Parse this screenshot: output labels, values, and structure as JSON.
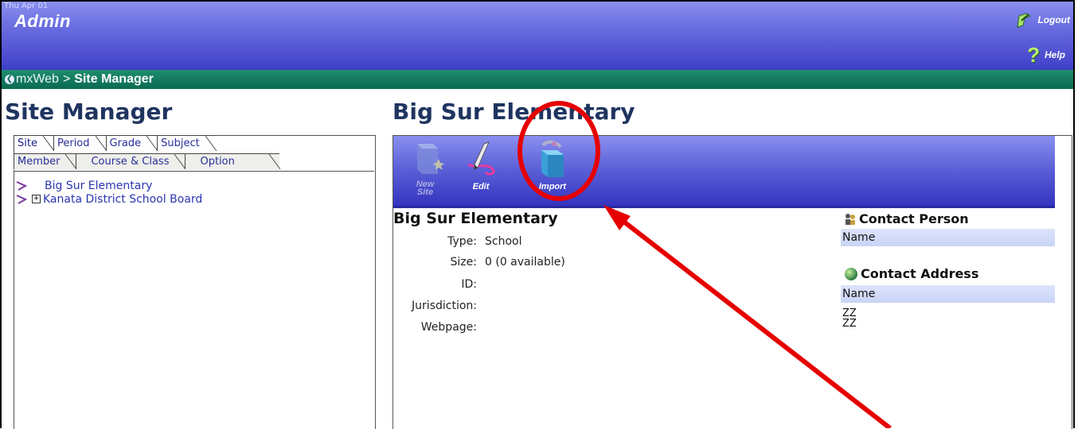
{
  "header": {
    "date": "Thu Apr 01",
    "app_title": "Admin",
    "logout_label": "Logout",
    "help_label": "Help"
  },
  "breadcrumb": {
    "root": "mxWeb",
    "separator": ">",
    "current": "Site Manager"
  },
  "left": {
    "title": "Site Manager",
    "tabs_row1": [
      "Site",
      "Period",
      "Grade",
      "Subject"
    ],
    "tabs_row2": [
      "Member",
      "Course & Class",
      "Option"
    ],
    "tree": [
      {
        "label": "Big Sur Elementary",
        "expandable": false
      },
      {
        "label": "Kanata District School Board",
        "expandable": true
      }
    ]
  },
  "right": {
    "title": "Big Sur Elementary",
    "toolbar": {
      "new_site_label_line1": "New",
      "new_site_label_line2": "Site",
      "edit_label": "Edit",
      "import_label": "Import"
    },
    "detail": {
      "name": "Big Sur Elementary",
      "type_label": "Type:",
      "type_value": "School",
      "size_label": "Size:",
      "size_value": "0 (0 available)",
      "id_label": "ID:",
      "id_value": "",
      "jurisdiction_label": "Jurisdiction:",
      "jurisdiction_value": "",
      "webpage_label": "Webpage:",
      "webpage_value": ""
    },
    "contact_person": {
      "title": "Contact Person",
      "name_header": "Name"
    },
    "contact_address": {
      "title": "Contact Address",
      "name_header": "Name",
      "lines": [
        "ZZ",
        "ZZ"
      ]
    }
  },
  "colors": {
    "header_blue": "#5d62d8",
    "breadcrumb_green": "#0b6a52",
    "title_navy": "#1f3560",
    "annotation_red": "#e60000"
  }
}
